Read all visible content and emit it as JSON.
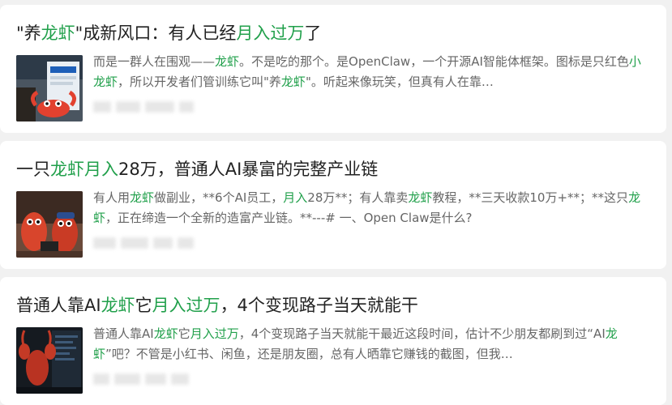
{
  "cards": [
    {
      "title_segments": [
        {
          "text": "\"养",
          "hl": false
        },
        {
          "text": "龙虾",
          "hl": true
        },
        {
          "text": "\"成新风口：有人已经",
          "hl": false
        },
        {
          "text": "月入过万",
          "hl": true
        },
        {
          "text": "了",
          "hl": false
        }
      ],
      "summary_segments": [
        {
          "text": "而是一群人在围观——",
          "hl": false
        },
        {
          "text": "龙虾",
          "hl": true
        },
        {
          "text": "。不是吃的那个。是OpenClaw，一个开源AI智能体框架。图标是只红色",
          "hl": false
        },
        {
          "text": "小龙虾",
          "hl": true
        },
        {
          "text": "，所以开发者们管训练它叫\"养",
          "hl": false
        },
        {
          "text": "龙虾",
          "hl": true
        },
        {
          "text": "\"。听起来像玩笑，但真有人在靠…",
          "hl": false
        }
      ],
      "thumb_icon": "crayfish-poster-thumbnail"
    },
    {
      "title_segments": [
        {
          "text": "一只",
          "hl": false
        },
        {
          "text": "龙虾",
          "hl": true
        },
        {
          "text": "月入",
          "hl": true
        },
        {
          "text": "28万，普通人AI暴富的完整产业链",
          "hl": false
        }
      ],
      "summary_segments": [
        {
          "text": "有人用",
          "hl": false
        },
        {
          "text": "龙虾",
          "hl": true
        },
        {
          "text": "做副业，**6个AI员工，",
          "hl": false
        },
        {
          "text": "月入",
          "hl": true
        },
        {
          "text": "28万**；有人靠卖",
          "hl": false
        },
        {
          "text": "龙虾",
          "hl": true
        },
        {
          "text": "教程，**三天收款10万+**；**这只",
          "hl": false
        },
        {
          "text": "龙虾",
          "hl": true
        },
        {
          "text": "，正在缔造一个全新的造富产业链。**---# 一、Open Claw是什么?",
          "hl": false
        }
      ],
      "thumb_icon": "cartoon-crayfish-thumbnail"
    },
    {
      "title_segments": [
        {
          "text": "普通人靠AI",
          "hl": false
        },
        {
          "text": "龙虾",
          "hl": true
        },
        {
          "text": "它",
          "hl": false
        },
        {
          "text": "月入过万",
          "hl": true
        },
        {
          "text": "，4个变现路子当天就能干",
          "hl": false
        }
      ],
      "summary_segments": [
        {
          "text": "普通人靠AI",
          "hl": false
        },
        {
          "text": "龙虾",
          "hl": true
        },
        {
          "text": "它",
          "hl": false
        },
        {
          "text": "月入过万",
          "hl": true
        },
        {
          "text": "，4个变现路子当天就能干最近这段时间，估计不少朋友都刷到过“AI",
          "hl": false
        },
        {
          "text": "龙虾",
          "hl": true
        },
        {
          "text": "”吧？不管是小红书、闲鱼，还是朋友圈，总有人晒靠它赚钱的截图，但我…",
          "hl": false
        }
      ],
      "thumb_icon": "crayfish-screen-thumbnail"
    }
  ],
  "colors": {
    "highlight": "#21a04b",
    "title": "#222222",
    "summary": "#666666",
    "background": "#f1f1f1",
    "card": "#ffffff"
  }
}
